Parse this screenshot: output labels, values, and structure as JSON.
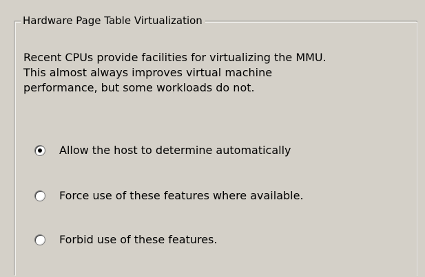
{
  "group": {
    "title": "Hardware Page Table Virtualization"
  },
  "description": {
    "lines": [
      "Recent CPUs provide facilities for virtualizing the MMU.",
      "This almost always improves virtual machine",
      "performance, but some workloads do not."
    ]
  },
  "options": [
    {
      "label": "Allow the host to determine automatically",
      "checked": true
    },
    {
      "label": "Force use of these features where available.",
      "checked": false
    },
    {
      "label": "Forbid use of these features.",
      "checked": false
    }
  ]
}
